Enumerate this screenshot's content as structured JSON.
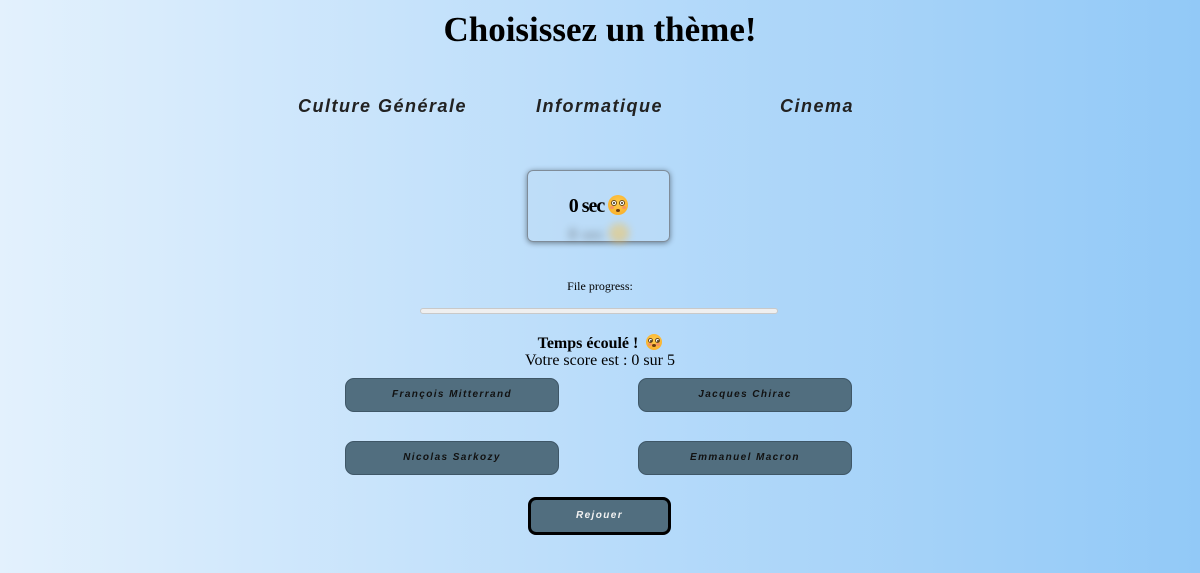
{
  "header": {
    "title": "Choisissez un thème!"
  },
  "themes": [
    {
      "label": "Culture Générale"
    },
    {
      "label": "Informatique"
    },
    {
      "label": "Cinema"
    }
  ],
  "timer": {
    "text": "0 sec",
    "icon": "flushed-face-emoji"
  },
  "progress": {
    "label": "File progress:",
    "value": 0,
    "fill_color": "#2f7fe0"
  },
  "result": {
    "title": "Temps écoulé !",
    "title_icon": "flushed-face-emoji",
    "score": "Votre score est : 0 sur 5"
  },
  "answers": [
    {
      "label": "François Mitterrand"
    },
    {
      "label": "Jacques Chirac"
    },
    {
      "label": "Nicolas Sarkozy"
    },
    {
      "label": "Emmanuel Macron"
    }
  ],
  "replay": {
    "label": "Rejouer"
  },
  "colors": {
    "button_bg": "#516e7f",
    "background_left": "#e3f1fd",
    "background_right": "#92c9f7"
  }
}
